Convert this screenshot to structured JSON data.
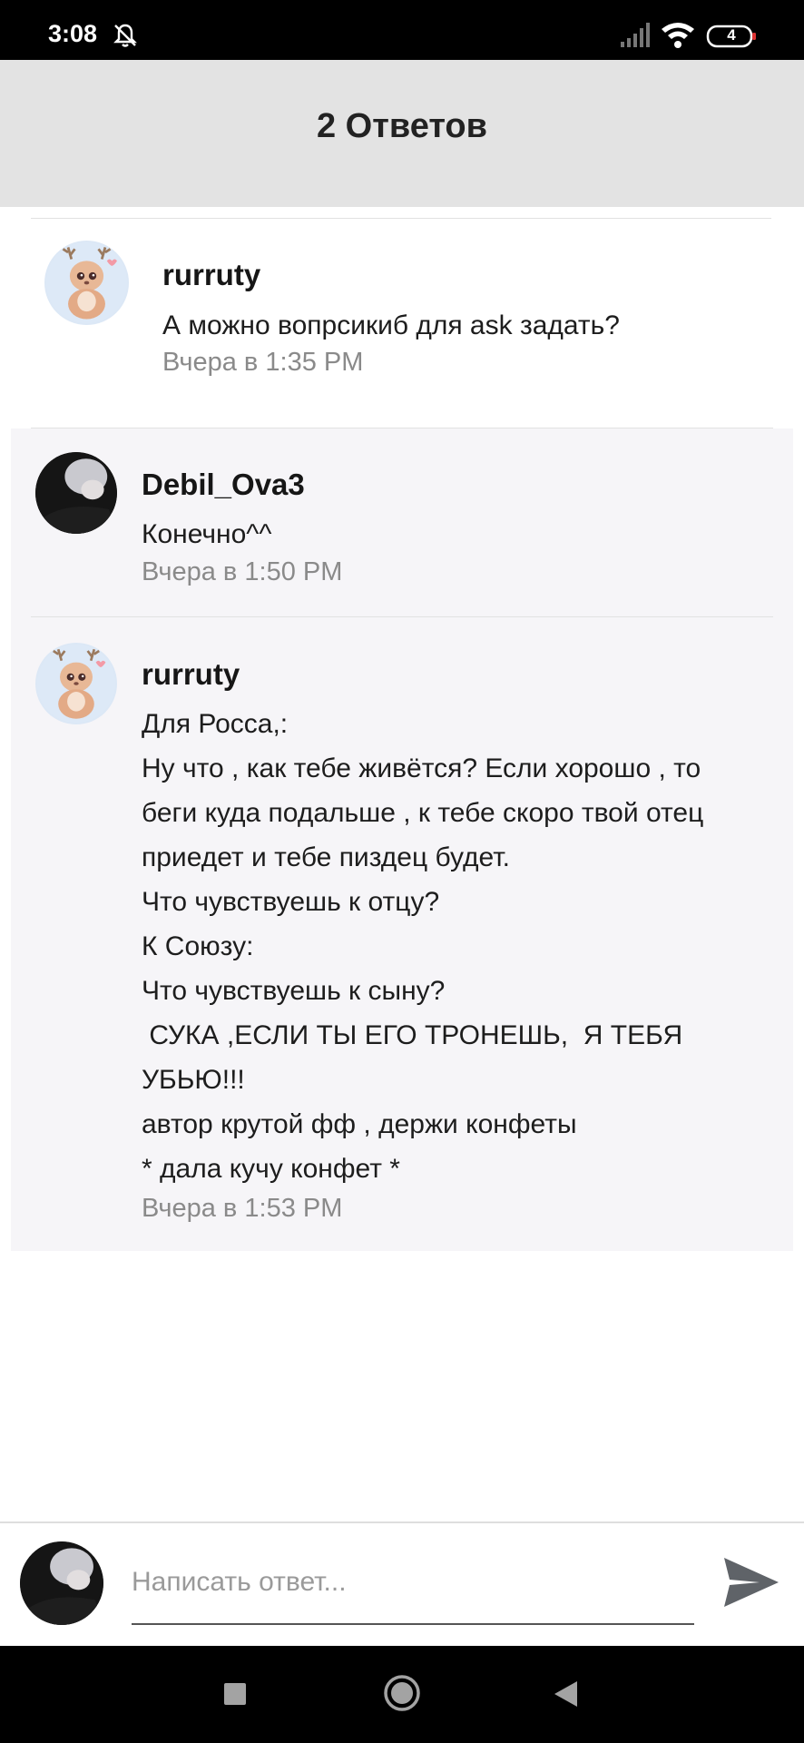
{
  "status": {
    "time": "3:08",
    "battery": "4",
    "icons": [
      "bell-muted-icon",
      "signal-icon",
      "wifi-icon",
      "battery-icon"
    ]
  },
  "header": {
    "title": "2 Ответов"
  },
  "comment": {
    "author": "rurruty",
    "text": "А можно вопрсикиб для ask задать?",
    "time": "Вчера в 1:35 PM"
  },
  "replies": [
    {
      "author": "Debil_Ova3",
      "text": "Конечно^^",
      "time": "Вчера в 1:50 PM"
    },
    {
      "author": "rurruty",
      "lines": [
        "Для Росса,:",
        "Ну что , как тебе живётся?  Если хорошо , то",
        "беги куда подальше , к тебе скоро твой отец",
        "приедет и тебе пиздец будет.",
        "Что чувствуешь к отцу?",
        "К Союзу:",
        "Что чувствуешь  к сыну?",
        " СУКА ,ЕСЛИ ТЫ ЕГО ТРОНЕШЬ,  Я ТЕБЯ",
        "УБЬЮ!!!",
        "автор крутой фф , держи конфеты",
        "* дала кучу конфет *"
      ],
      "time": "Вчера в 1:53 PM"
    }
  ],
  "input": {
    "placeholder": "Написать ответ..."
  },
  "colors": {
    "header_bg": "#e3e3e3",
    "reply_bg": "#f6f5f8",
    "timestamp": "#8a8a8a",
    "send_icon": "#5f6368"
  }
}
